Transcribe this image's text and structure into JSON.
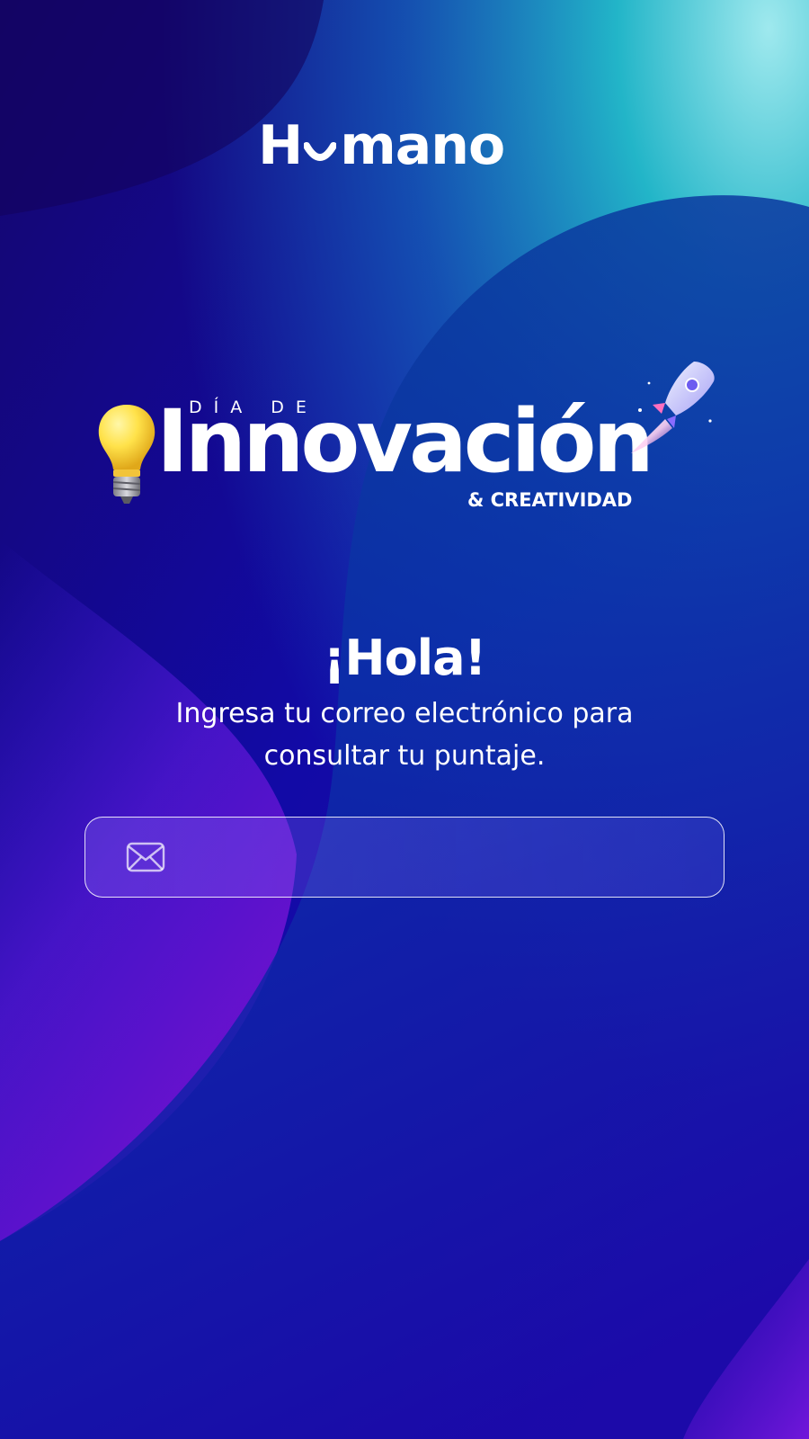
{
  "brand": {
    "logo_text_start": "H",
    "logo_text_end": "mano",
    "logo_full": "Humano"
  },
  "event": {
    "prefix": "DÍA DE",
    "title": "Innovación",
    "suffix": "& CREATIVIDAD",
    "icons": [
      "lightbulb-icon",
      "rocket-icon"
    ]
  },
  "greeting": "¡Hola!",
  "subtitle": "Ingresa tu correo electrónico para consultar tu puntaje.",
  "email_field": {
    "value": "",
    "placeholder": "",
    "icon": "envelope-icon"
  },
  "colors": {
    "background_dark": "#1a0a9c",
    "background_teal": "#1fb5c9",
    "background_purple": "#6b12c9",
    "text": "#ffffff",
    "bulb_yellow": "#ffe24a"
  }
}
